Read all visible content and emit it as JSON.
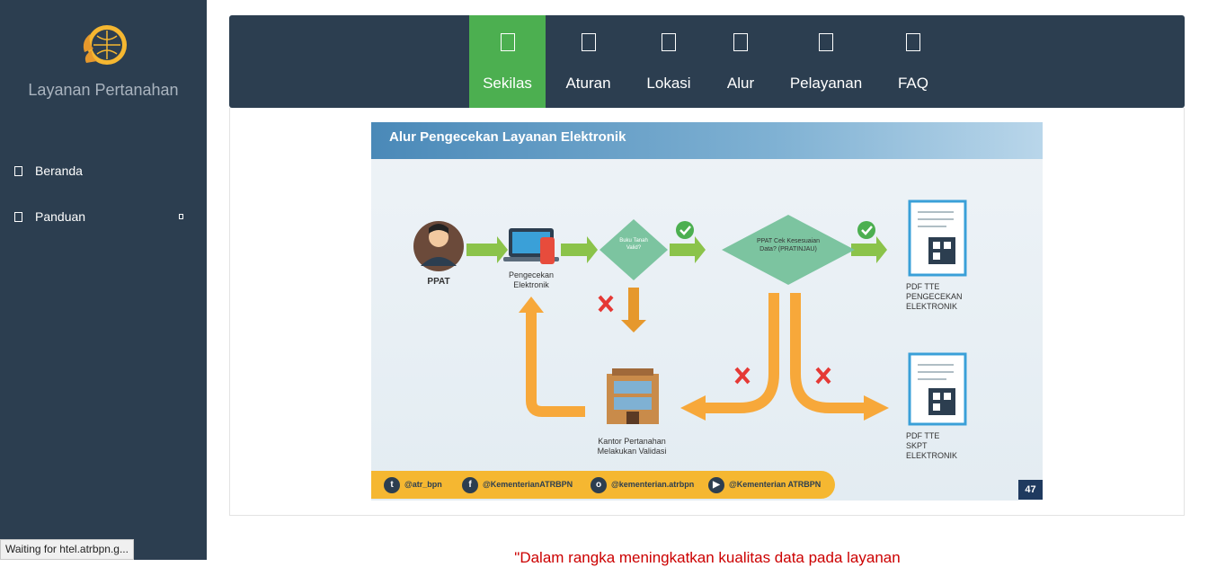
{
  "sidebar": {
    "app_title": "Layanan Pertanahan",
    "items": [
      {
        "label": "Beranda",
        "icon": "home-icon"
      },
      {
        "label": "Panduan",
        "icon": "book-icon"
      }
    ]
  },
  "tabs": [
    {
      "label": "Sekilas",
      "active": true
    },
    {
      "label": "Aturan",
      "active": false
    },
    {
      "label": "Lokasi",
      "active": false
    },
    {
      "label": "Alur",
      "active": false
    },
    {
      "label": "Pelayanan",
      "active": false
    },
    {
      "label": "FAQ",
      "active": false
    }
  ],
  "slide": {
    "title": "Alur Pengecekan Layanan Elektronik",
    "ppat": "PPAT",
    "pengecekan": "Pengecekan Elektronik",
    "buku_tanah": "Buku Tanah Valid?",
    "pratinjau": "PPAT Cek Kesesuaian Data? (PRATINJAU)",
    "pdf_pengecekan": "PDF TTE PENGECEKAN ELEKTRONIK",
    "pdf_skpt": "PDF TTE SKPT ELEKTRONIK",
    "kantor": "Kantor Pertanahan Melakukan Validasi",
    "social": [
      "@atr_bpn",
      "@KementerianATRBPN",
      "@kementerian.atrbpn",
      "@Kementerian ATRBPN"
    ],
    "page_number": "47"
  },
  "notice": "\"Dalam rangka meningkatkan kualitas data pada layanan",
  "status_text": "Waiting for htel.atrbpn.g...",
  "colors": {
    "sidebar": "#2c3e50",
    "active_tab": "#4caf50",
    "notice": "#cc0000"
  }
}
